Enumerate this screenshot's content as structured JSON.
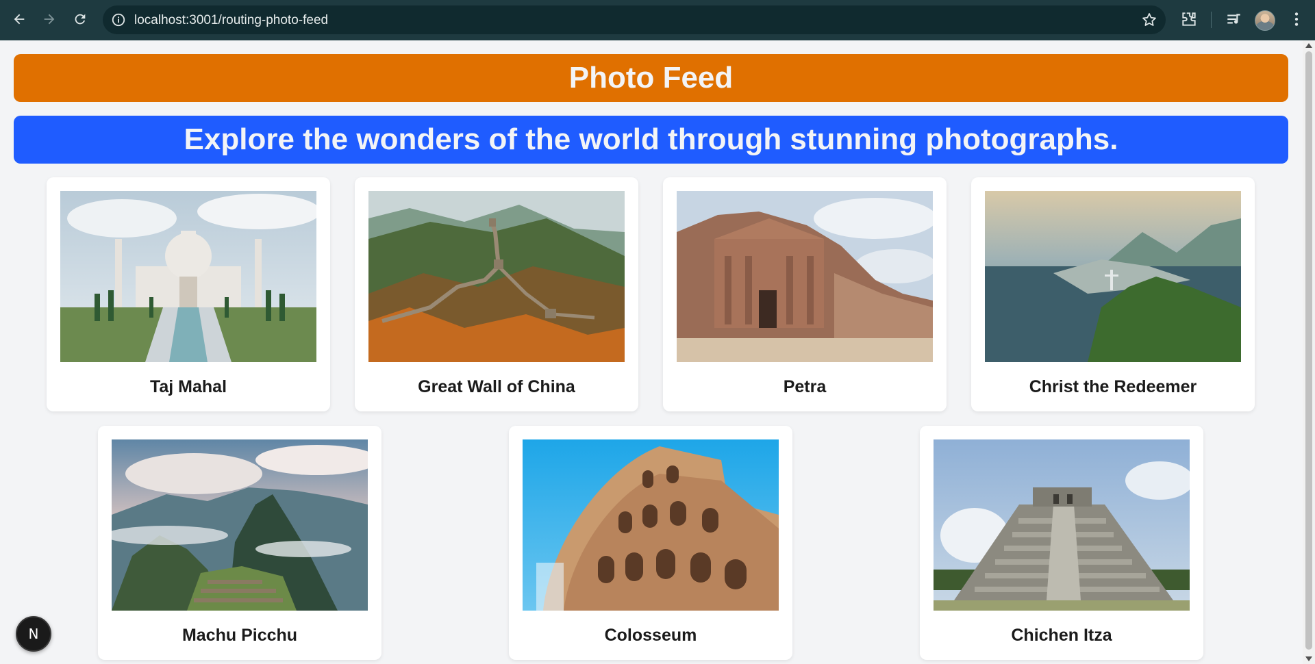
{
  "browser": {
    "url": "localhost:3001/routing-photo-feed"
  },
  "page": {
    "title": "Photo Feed",
    "subtitle": "Explore the wonders of the world through stunning photographs."
  },
  "photos": [
    {
      "caption": "Taj Mahal"
    },
    {
      "caption": "Great Wall of China"
    },
    {
      "caption": "Petra"
    },
    {
      "caption": "Christ the Redeemer"
    },
    {
      "caption": "Machu Picchu"
    },
    {
      "caption": "Colosseum"
    },
    {
      "caption": "Chichen Itza"
    }
  ],
  "dev_badge": {
    "label": "N"
  },
  "colors": {
    "title_banner": "#e07000",
    "subtitle_banner": "#1f5cff",
    "page_background": "#f3f4f6"
  }
}
